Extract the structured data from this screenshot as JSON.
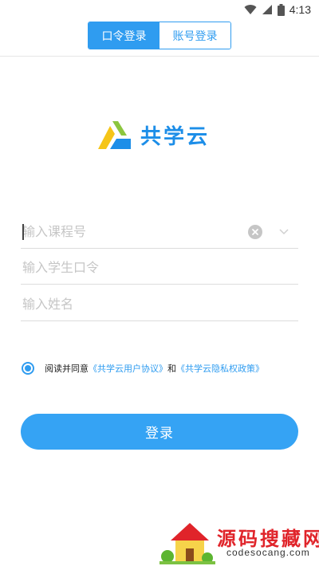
{
  "status_bar": {
    "time": "4:13",
    "icons": [
      "wifi-icon",
      "signal-icon",
      "battery-icon"
    ]
  },
  "header": {
    "tabs": [
      {
        "label": "口令登录",
        "active": true
      },
      {
        "label": "账号登录",
        "active": false
      }
    ]
  },
  "logo": {
    "text": "共学云"
  },
  "form": {
    "course_placeholder": "输入课程号",
    "code_placeholder": "输入学生口令",
    "name_placeholder": "输入姓名",
    "course_value": "",
    "code_value": "",
    "name_value": ""
  },
  "agreement": {
    "checked": true,
    "prefix": "阅读并同意",
    "user_agreement": "《共学云用户协议》",
    "conjunction": "和",
    "privacy_policy": "《共学云隐私权政策》"
  },
  "login_button": {
    "label": "登录"
  },
  "watermark": {
    "title": "源码搜藏网",
    "url": "codesocang.com"
  },
  "colors": {
    "accent": "#2f9cf0",
    "button": "#35a3f4",
    "logo": "#1d8ee8",
    "watermark": "#e0242a"
  }
}
